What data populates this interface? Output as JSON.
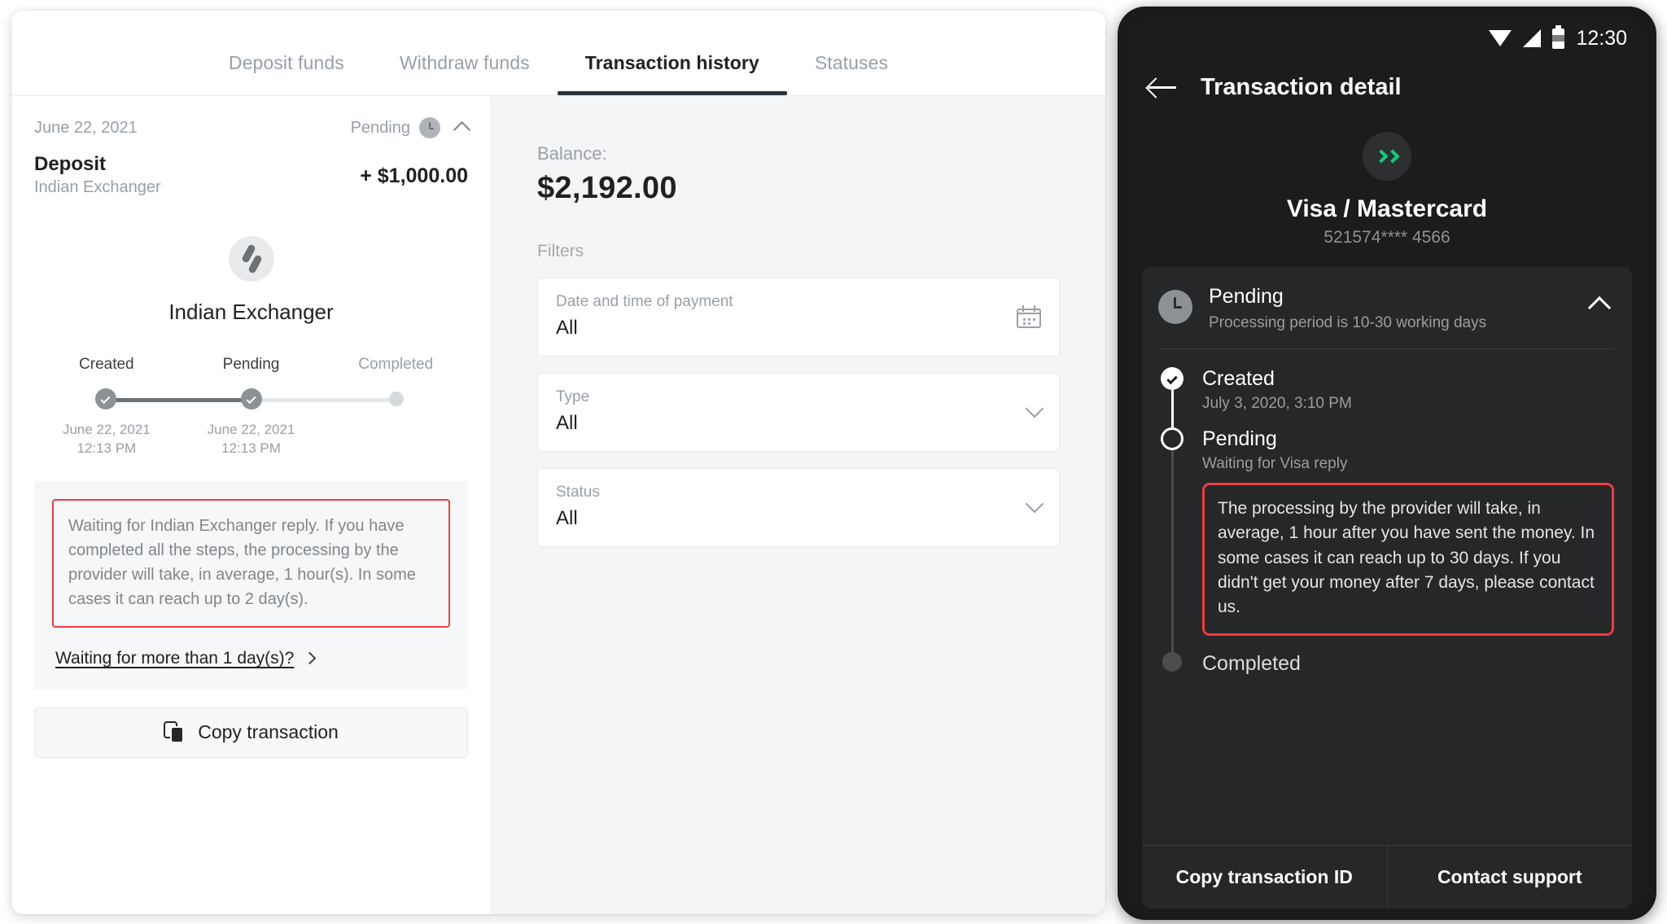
{
  "desktop": {
    "tabs": [
      {
        "label": "Deposit funds",
        "active": false
      },
      {
        "label": "Withdraw funds",
        "active": false
      },
      {
        "label": "Transaction history",
        "active": true
      },
      {
        "label": "Statuses",
        "active": false
      }
    ],
    "transaction": {
      "date": "June 22, 2021",
      "status": "Pending",
      "type": "Deposit",
      "provider": "Indian Exchanger",
      "amount": "+ $1,000.00",
      "provider_title": "Indian Exchanger",
      "steps": [
        {
          "label": "Created",
          "date": "June 22, 2021 12:13 PM",
          "state": "done"
        },
        {
          "label": "Pending",
          "date": "June 22, 2021 12:13 PM",
          "state": "done"
        },
        {
          "label": "Completed",
          "date": "",
          "state": "todo"
        }
      ],
      "warning": "Waiting for Indian Exchanger reply. If you have completed all the steps, the processing by the provider will take, in average, 1 hour(s). In some cases it can reach up to 2 day(s).",
      "wait_link": "Waiting for more than 1 day(s)?",
      "copy_button": "Copy transaction"
    },
    "sidebar": {
      "balance_label": "Balance:",
      "balance_value": "$2,192.00",
      "filters_label": "Filters",
      "filters": [
        {
          "label": "Date and time of payment",
          "value": "All",
          "icon": "calendar-icon"
        },
        {
          "label": "Type",
          "value": "All",
          "icon": "chevron-down-icon"
        },
        {
          "label": "Status",
          "value": "All",
          "icon": "chevron-down-icon"
        }
      ]
    }
  },
  "phone": {
    "statusbar": {
      "time": "12:30"
    },
    "header": {
      "title": "Transaction detail"
    },
    "card": {
      "name": "Visa / Mastercard",
      "number": "521574**** 4566",
      "accent": "#0ace7a"
    },
    "status": {
      "title": "Pending",
      "subtitle": "Processing period is 10-30 working days"
    },
    "timeline": [
      {
        "title": "Created",
        "subtitle": "July 3, 2020, 3:10 PM",
        "state": "done"
      },
      {
        "title": "Pending",
        "subtitle": "Waiting for Visa reply",
        "state": "current"
      },
      {
        "title": "Completed",
        "subtitle": "",
        "state": "todo"
      }
    ],
    "warning": "The processing by the provider will take, in average, 1 hour after you have sent the money. In some cases it can reach up to 30 days. If you didn't get your money after 7 days, please contact us.",
    "footer": {
      "copy_label": "Copy transaction ID",
      "support_label": "Contact support"
    }
  },
  "colors": {
    "warning_border": "#ef3e42",
    "accent_green": "#0ace7a",
    "text_primary": "#202124",
    "text_muted": "#9aa0a6"
  }
}
